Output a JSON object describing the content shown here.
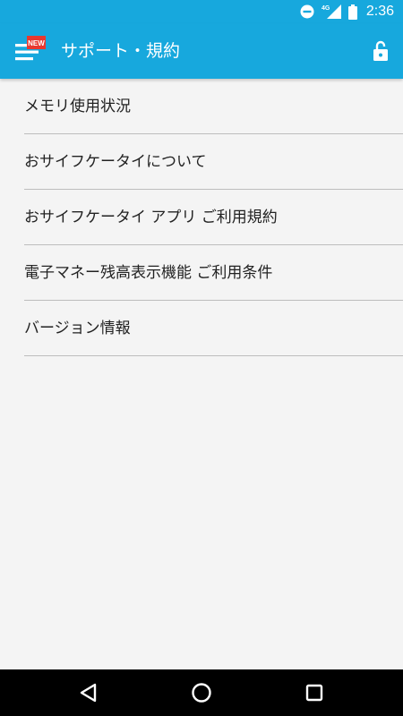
{
  "status_bar": {
    "time": "2:36",
    "network": "4G",
    "icons": [
      "do-not-disturb-icon",
      "signal-icon",
      "battery-icon"
    ]
  },
  "app_bar": {
    "title": "サポート・規約",
    "menu_badge": "NEW",
    "icons": [
      "menu-icon",
      "unlock-icon"
    ]
  },
  "menu": {
    "items": [
      {
        "label": "メモリ使用状況"
      },
      {
        "label": "おサイフケータイについて"
      },
      {
        "label": "おサイフケータイ アプリ ご利用規約"
      },
      {
        "label": "電子マネー残高表示機能 ご利用条件"
      },
      {
        "label": "バージョン情報"
      }
    ]
  },
  "nav_bar": {
    "icons": [
      "back-icon",
      "home-icon",
      "recents-icon"
    ]
  },
  "colors": {
    "accent": "#17a8dd",
    "badge": "#e8382f",
    "background": "#f4f4f4",
    "divider": "#bdbdbd",
    "text": "#222222"
  }
}
